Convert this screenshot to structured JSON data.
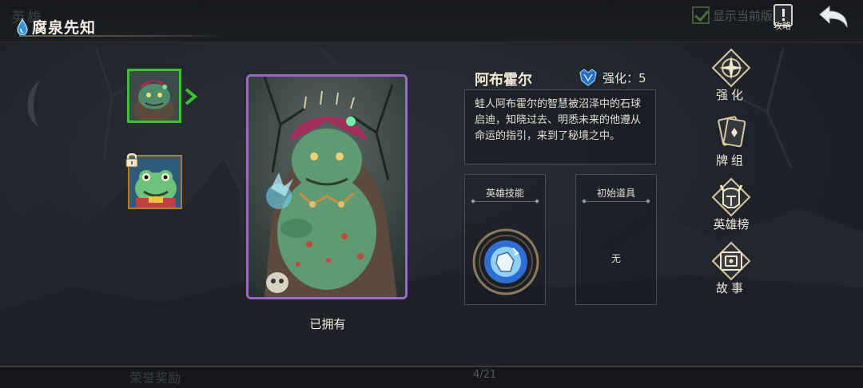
{
  "header": {
    "ghost_title": "英雄",
    "title": "腐泉先知",
    "show_current_label": "显示当前版",
    "guide_label": "攻略"
  },
  "hero_list": {
    "items": [
      {
        "name": "阿布霍尔",
        "selected": true,
        "locked": false
      },
      {
        "name": "locked-hero",
        "selected": false,
        "locked": true
      }
    ]
  },
  "card": {
    "status_label": "已拥有"
  },
  "hero": {
    "name": "阿布霍尔",
    "upgrade_label": "强化：5",
    "description": "蛙人阿布霍尔的智慧被沼泽中的石球启迪，知晓过去、明悉未来的他遵从命运的指引，来到了秘境之中。",
    "skill_header": "英雄技能",
    "item_header": "初始道具",
    "item_value": "无"
  },
  "menu": {
    "upgrade": "强化",
    "deck": "牌组",
    "ranking": "英雄榜",
    "story": "故事"
  },
  "footer": {
    "ghost_label": "荣誉奖励",
    "page_indicator": "4/21"
  },
  "colors": {
    "selected_border": "#39c42c",
    "card_border": "#9b6ac9",
    "locked_border": "#b07a2c",
    "accent_blue": "#3a8fd8"
  },
  "icons": [
    "drop-icon",
    "checkbox-icon",
    "guide-icon",
    "back-arrow-icon",
    "lock-icon",
    "chevron-right-icon",
    "upgrade-gem-icon",
    "skill-orb-icon",
    "upgrade-compass-icon",
    "deck-cards-icon",
    "ranking-helmet-icon",
    "story-book-icon"
  ]
}
